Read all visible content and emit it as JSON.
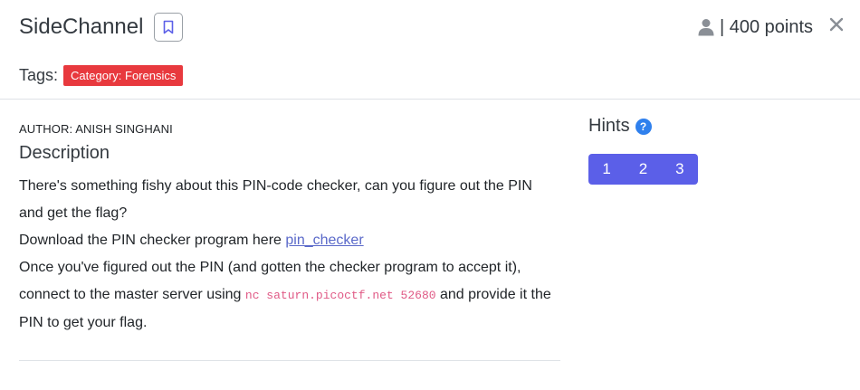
{
  "challenge": {
    "title": "SideChannel",
    "points_text": "| 400 points"
  },
  "icons": {
    "bookmark": "bookmark-icon",
    "user": "user-icon",
    "close": "close-icon",
    "help": "help-icon"
  },
  "tags": {
    "label": "Tags:",
    "items": [
      "Category: Forensics"
    ],
    "color": "#e8393e"
  },
  "author": "AUTHOR: ANISH SINGHANI",
  "description": {
    "heading": "Description",
    "line1": "There's something fishy about this PIN-code checker, can you figure out the PIN and get the flag?",
    "line2_prefix": "Download the PIN checker program here ",
    "line2_link": "pin_checker",
    "line3_prefix": "Once you've figured out the PIN (and gotten the checker program to accept it), connect to the master server using ",
    "line3_code": "nc saturn.picoctf.net 52680",
    "line3_suffix": " and provide it the PIN to get your flag."
  },
  "hints": {
    "title": "Hints",
    "help_glyph": "?",
    "buttons": [
      "1",
      "2",
      "3"
    ],
    "color": "#5b5fe8"
  }
}
